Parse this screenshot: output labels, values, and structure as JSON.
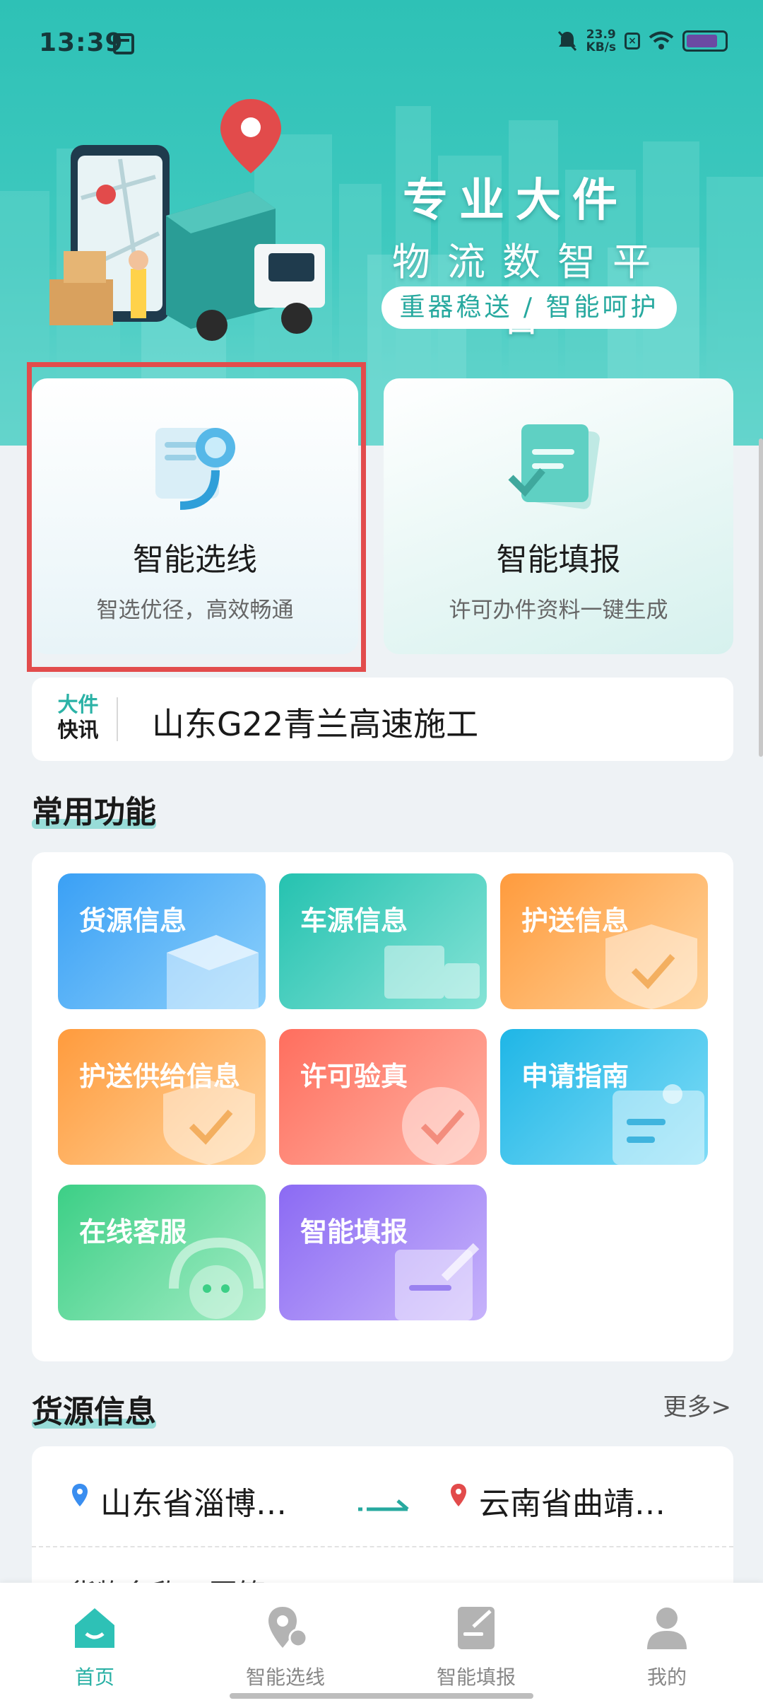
{
  "status_bar": {
    "time": "13:39",
    "speed_value": "23.9",
    "speed_unit": "KB/s",
    "box_icon_text": "×"
  },
  "hero": {
    "title": "专业大件",
    "subtitle": "物流数智平台",
    "tagline": "重器稳送 / 智能呵护",
    "bg_color": "#2ec1b6"
  },
  "feature_cards": [
    {
      "title": "智能选线",
      "desc": "智选优径，高效畅通",
      "icon": "route-robot-icon"
    },
    {
      "title": "智能填报",
      "desc": "许可办件资料一键生成",
      "icon": "document-form-icon"
    }
  ],
  "news": {
    "logo_line1": "大件",
    "logo_line2": "快讯",
    "text": "山东G22青兰高速施工"
  },
  "common_functions": {
    "title": "常用功能",
    "tiles": [
      {
        "label": "货源信息",
        "icon": "box-icon"
      },
      {
        "label": "车源信息",
        "icon": "truck-icon"
      },
      {
        "label": "护送信息",
        "icon": "shield-check-icon"
      },
      {
        "label": "护送供给信息",
        "icon": "shield-check-icon"
      },
      {
        "label": "许可验真",
        "icon": "badge-check-icon"
      },
      {
        "label": "申请指南",
        "icon": "id-card-icon"
      },
      {
        "label": "在线客服",
        "icon": "headset-icon"
      },
      {
        "label": "智能填报",
        "icon": "document-edit-icon"
      }
    ]
  },
  "cargo_section": {
    "title": "货源信息",
    "more": "更多>",
    "route": {
      "from": "山东省淄博…",
      "to": "云南省曲靖…"
    },
    "goods_partial": "货物名称：圆筒"
  },
  "tabbar": {
    "items": [
      {
        "label": "首页",
        "icon": "home-icon",
        "active": true
      },
      {
        "label": "智能选线",
        "icon": "route-pin-icon",
        "active": false
      },
      {
        "label": "智能填报",
        "icon": "form-edit-icon",
        "active": false
      },
      {
        "label": "我的",
        "icon": "user-icon",
        "active": false
      }
    ]
  },
  "colors": {
    "accent": "#2ec1b6",
    "highlight_border": "#e24c4c",
    "active_tab": "#28b0a4"
  }
}
